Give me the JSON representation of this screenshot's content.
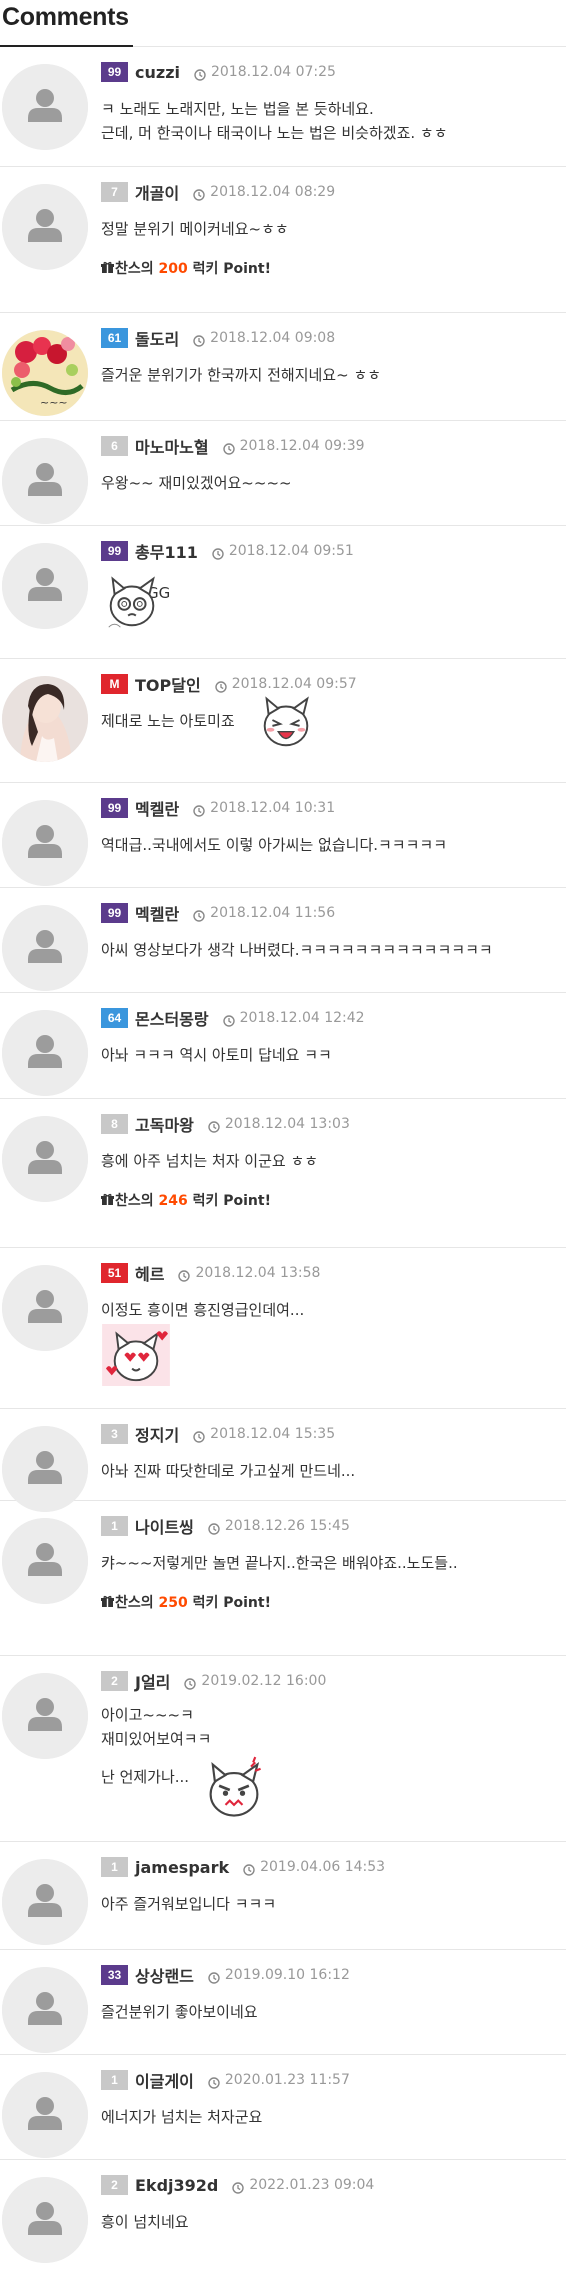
{
  "header": {
    "title": "Comments"
  },
  "colors": {
    "purple": "#5b3b8c",
    "gray": "#c8c8c8",
    "blue": "#3a96dd",
    "red": "#e0262d",
    "point": "#ff4a00"
  },
  "comments": [
    {
      "level": "99",
      "level_color": "#5b3b8c",
      "nick": "cuzzi",
      "date": "2018.12.04 07:25",
      "lines": [
        "ㅋ 노래도 노래지만, 노는 법을 본 듯하네요.",
        "근데, 머 한국이나 태국이나 노는 법은 비슷하겠죠. ㅎㅎ"
      ],
      "avatar": "default"
    },
    {
      "level": "7",
      "level_color": "#c8c8c8",
      "nick": "개골이",
      "date": "2018.12.04 08:29",
      "lines": [
        "정말 분위기 메이커네요~ㅎㅎ"
      ],
      "avatar": "default",
      "point": {
        "prefix": "찬스의 ",
        "amount": "200",
        "suffix": " 럭키 Point!"
      }
    },
    {
      "level": "61",
      "level_color": "#3a96dd",
      "nick": "돌도리",
      "date": "2018.12.04 09:08",
      "lines": [
        "즐거운 분위기가 한국까지 전해지네요~ ㅎㅎ"
      ],
      "avatar": "flowers"
    },
    {
      "level": "6",
      "level_color": "#c8c8c8",
      "nick": "마노마노혈",
      "date": "2018.12.04 09:39",
      "lines": [
        "우왕~~ 재미있겠어요~~~~"
      ],
      "avatar": "default"
    },
    {
      "level": "99",
      "level_color": "#5b3b8c",
      "nick": "총무111",
      "date": "2018.12.04 09:51",
      "lines": [
        "GG"
      ],
      "avatar": "default",
      "emoticon": "dizzy-cat-emoticon"
    },
    {
      "level": "M",
      "level_color": "#e0262d",
      "nick": "TOP달인",
      "date": "2018.12.04 09:57",
      "lines": [
        "제대로 노는 아토미죠"
      ],
      "avatar": "photo",
      "emoticon": "laughing-cat-emoticon"
    },
    {
      "level": "99",
      "level_color": "#5b3b8c",
      "nick": "멕켈란",
      "date": "2018.12.04 10:31",
      "lines": [
        "역대급..국내에서도 이렇 아가씨는 없습니다.ㅋㅋㅋㅋㅋ"
      ],
      "avatar": "default"
    },
    {
      "level": "99",
      "level_color": "#5b3b8c",
      "nick": "멕켈란",
      "date": "2018.12.04 11:56",
      "lines": [
        "아씨 영상보다가 생각 나버렸다.ㅋㅋㅋㅋㅋㅋㅋㅋㅋㅋㅋㅋㅋㅋ"
      ],
      "avatar": "default"
    },
    {
      "level": "64",
      "level_color": "#3a96dd",
      "nick": "몬스터몽랑",
      "date": "2018.12.04 12:42",
      "lines": [
        "아놔 ㅋㅋㅋ 역시 아토미 답네요 ㅋㅋ"
      ],
      "avatar": "default"
    },
    {
      "level": "8",
      "level_color": "#c8c8c8",
      "nick": "고독마왕",
      "date": "2018.12.04 13:03",
      "lines": [
        "흥에 아주 넘치는 처자 이군요 ㅎㅎ"
      ],
      "avatar": "default",
      "point": {
        "prefix": "찬스의 ",
        "amount": "246",
        "suffix": " 럭키 Point!"
      }
    },
    {
      "level": "51",
      "level_color": "#e0262d",
      "nick": "헤르",
      "date": "2018.12.04 13:58",
      "lines": [
        "이정도 흥이면 흥진영급인데여..."
      ],
      "avatar": "default",
      "emoticon": "love-cat-emoticon"
    },
    {
      "level": "3",
      "level_color": "#c8c8c8",
      "nick": "정지기",
      "date": "2018.12.04 15:35",
      "lines": [
        "아놔 진짜 따닷한데로 가고싶게 만드네..."
      ],
      "avatar": "default"
    },
    {
      "level": "1",
      "level_color": "#c8c8c8",
      "nick": "나이트씽",
      "date": "2018.12.26 15:45",
      "lines": [
        "캬~~~저렇게만 놀면 끝나지..한국은 배워야죠..노도들.."
      ],
      "avatar": "default",
      "point": {
        "prefix": "찬스의 ",
        "amount": "250",
        "suffix": " 럭키 Point!"
      }
    },
    {
      "level": "2",
      "level_color": "#c8c8c8",
      "nick": "J얼리",
      "date": "2019.02.12 16:00",
      "lines": [
        "아이고~~~ㅋ",
        "재미있어보여ㅋㅋ",
        "난 언제가나..."
      ],
      "avatar": "default",
      "emoticon": "angry-cat-emoticon"
    },
    {
      "level": "1",
      "level_color": "#c8c8c8",
      "nick": "jamespark",
      "date": "2019.04.06 14:53",
      "lines": [
        "아주 즐거워보입니다 ㅋㅋㅋ"
      ],
      "avatar": "default"
    },
    {
      "level": "33",
      "level_color": "#5b3b8c",
      "nick": "상상랜드",
      "date": "2019.09.10 16:12",
      "lines": [
        "즐건분위기 좋아보이네요"
      ],
      "avatar": "default"
    },
    {
      "level": "1",
      "level_color": "#c8c8c8",
      "nick": "이글게이",
      "date": "2020.01.23 11:57",
      "lines": [
        "에너지가 넘치는 처자군요"
      ],
      "avatar": "default"
    },
    {
      "level": "2",
      "level_color": "#c8c8c8",
      "nick": "Ekdj392d",
      "date": "2022.01.23 09:04",
      "lines": [
        "흥이 넘치네요"
      ],
      "avatar": "default"
    }
  ]
}
